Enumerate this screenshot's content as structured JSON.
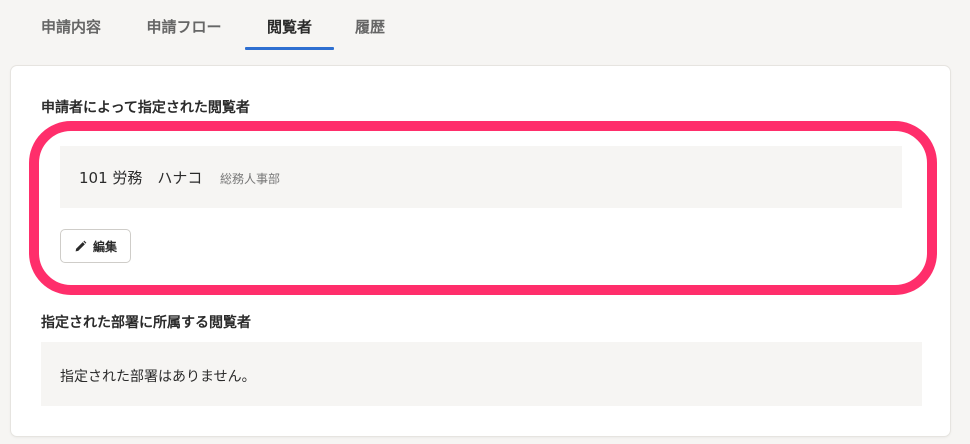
{
  "tabs": [
    {
      "label": "申請内容",
      "active": false
    },
    {
      "label": "申請フロー",
      "active": false
    },
    {
      "label": "閲覧者",
      "active": true
    },
    {
      "label": "履歴",
      "active": false
    }
  ],
  "applicant_section": {
    "title": "申請者によって指定された閲覧者",
    "viewer": {
      "name": "101 労務　ハナコ",
      "department": "総務人事部"
    },
    "edit_button_label": "編集"
  },
  "department_section": {
    "title": "指定された部署に所属する閲覧者",
    "empty_message": "指定された部署はありません。"
  },
  "colors": {
    "accent": "#2e6fd1",
    "highlight": "#ff2e6b",
    "panel_bg": "#f6f5f3"
  },
  "icons": {
    "edit": "pencil-icon"
  }
}
